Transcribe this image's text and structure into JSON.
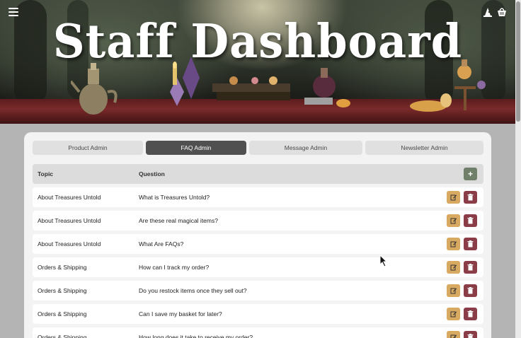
{
  "hero": {
    "title": "Staff Dashboard"
  },
  "icons": {
    "menu": "hamburger-menu-icon",
    "profile": "wizard-hat-icon",
    "basket": "basket-icon",
    "add": "plus-icon",
    "edit": "pencil-square-icon",
    "delete": "trash-icon"
  },
  "colors": {
    "active_tab": "#505050",
    "add_button": "#6f7f6a",
    "edit_button": "#d8a960",
    "delete_button": "#8b3d47"
  },
  "tabs": [
    {
      "label": "Product Admin",
      "active": false
    },
    {
      "label": "FAQ Admin",
      "active": true
    },
    {
      "label": "Message Admin",
      "active": false
    },
    {
      "label": "Newsletter Admin",
      "active": false
    }
  ],
  "table": {
    "headers": {
      "topic": "Topic",
      "question": "Question"
    },
    "add_label": "+",
    "rows": [
      {
        "topic": "About Treasures Untold",
        "question": "What is Treasures Untold?"
      },
      {
        "topic": "About Treasures Untold",
        "question": "Are these real magical items?"
      },
      {
        "topic": "About Treasures Untold",
        "question": "What Are FAQs?"
      },
      {
        "topic": "Orders & Shipping",
        "question": "How can I track my order?"
      },
      {
        "topic": "Orders & Shipping",
        "question": "Do you restock items once they sell out?"
      },
      {
        "topic": "Orders & Shipping",
        "question": "Can I save my basket for later?"
      },
      {
        "topic": "Orders & Shipping",
        "question": "How long does it take to receive my order?"
      }
    ]
  }
}
